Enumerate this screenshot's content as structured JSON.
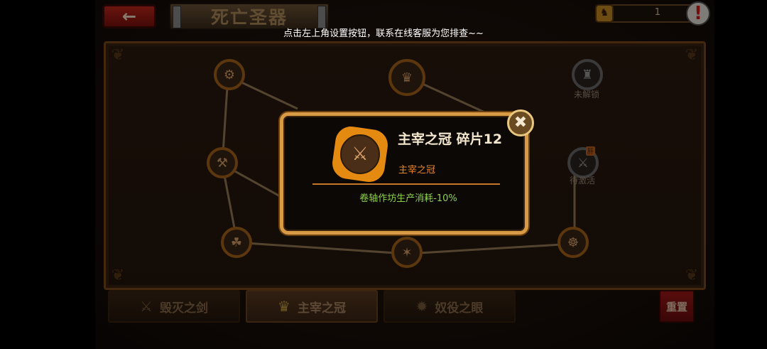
{
  "header": {
    "back_icon": "←",
    "title": "死亡圣器",
    "hint": "点击左上角设置按钮，联系在线客服为您排查~~",
    "resource_count": "1",
    "alert_symbol": "!"
  },
  "board": {
    "nodes": [
      {
        "label": "",
        "icon": "⚙"
      },
      {
        "label": "",
        "icon": "♛"
      },
      {
        "label": "未解锁",
        "icon": "♜"
      },
      {
        "label": "",
        "icon": "⚒"
      },
      {
        "label": "待激活",
        "icon": "⚔",
        "tag": "肝"
      },
      {
        "label": "",
        "icon": "☘"
      },
      {
        "label": "",
        "icon": "✶"
      },
      {
        "label": "",
        "icon": "☸"
      }
    ]
  },
  "tabs": [
    {
      "label": "毁灭之剑",
      "icon": "⚔"
    },
    {
      "label": "主宰之冠",
      "icon": "♛"
    },
    {
      "label": "奴役之眼",
      "icon": "✹"
    }
  ],
  "reset_label": "重置",
  "modal": {
    "title": "主宰之冠 碎片12",
    "subtitle": "主宰之冠",
    "effect": "卷轴作坊生产消耗-10%",
    "close_symbol": "✖",
    "icon": "⚔"
  },
  "colors": {
    "accent": "#d89a44",
    "effect_text": "#8ed24a",
    "subtitle_text": "#e8862a"
  }
}
